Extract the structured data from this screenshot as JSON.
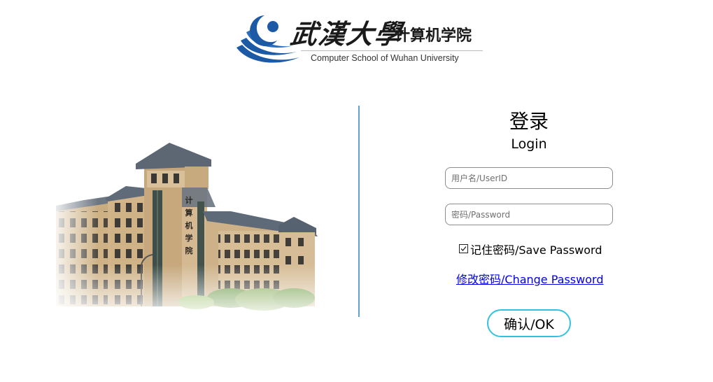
{
  "header": {
    "university_name": "武漢大學",
    "school_name": "计算机学院",
    "school_name_en": "Computer School of Wuhan University",
    "brand_color": "#1d5aa6"
  },
  "building": {
    "sign_text": "计算机学院"
  },
  "login": {
    "title_cn": "登录",
    "title_en": "Login",
    "userid": {
      "value": "",
      "placeholder": "用户名/UserID"
    },
    "password": {
      "value": "",
      "placeholder": "密码/Password"
    },
    "remember": {
      "icon": "checkbox-icon",
      "checked": false,
      "label": "记住密码/Save Password"
    },
    "change_password_label": "修改密码/Change Password",
    "submit_label": "确认/OK",
    "accent_color": "#34c1de",
    "divider_color": "#5fa2cc"
  }
}
